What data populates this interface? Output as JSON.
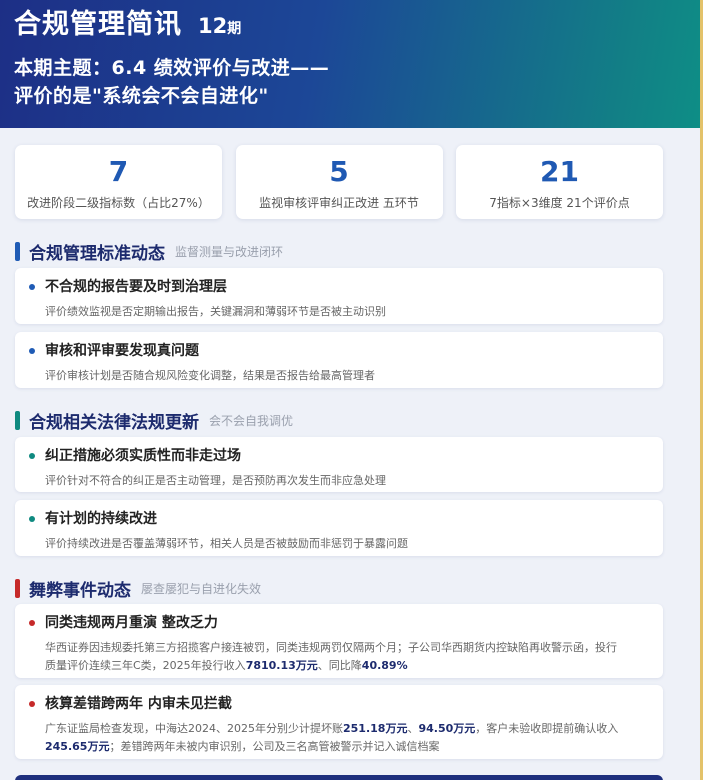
{
  "header": {
    "title": "合规管理简讯",
    "issue_number": "12",
    "issue_suffix": "期",
    "subtitle_line1": "本期主题：6.4 绩效评价与改进——",
    "subtitle_line2": "评价的是\"系统会不会自进化\""
  },
  "stats": [
    {
      "value": "7",
      "label": "改进阶段二级指标数（占比27%）"
    },
    {
      "value": "5",
      "label": "监视审核评审纠正改进 五环节"
    },
    {
      "value": "21",
      "label": "7指标×3维度 21个评价点"
    }
  ],
  "sections": [
    {
      "title": "合规管理标准动态",
      "subtitle": "监督测量与改进闭环",
      "color": "#1f5bb5",
      "items": [
        {
          "title": "不合规的报告要及时到治理层",
          "desc": "评价绩效监视是否定期输出报告，关键漏洞和薄弱环节是否被主动识别"
        },
        {
          "title": "审核和评审要发现真问题",
          "desc": "评价审核计划是否随合规风险变化调整，结果是否报告给最高管理者"
        }
      ]
    },
    {
      "title": "合规相关法律法规更新",
      "subtitle": "会不会自我调优",
      "color": "#0f8a80",
      "items": [
        {
          "title": "纠正措施必须实质性而非走过场",
          "desc": "评价针对不符合的纠正是否主动管理，是否预防再次发生而非应急处理"
        },
        {
          "title": "有计划的持续改进",
          "desc": "评价持续改进是否覆盖薄弱环节，相关人员是否被鼓励而非惩罚于暴露问题"
        }
      ]
    },
    {
      "title": "舞弊事件动态",
      "subtitle": "屡查屡犯与自进化失效",
      "color": "#c62a2a",
      "items": [
        {
          "title": "同类违规两月重演 整改乏力",
          "desc_line1": "华西证券因违规委托第三方招揽客户接连被罚，同类违规两罚仅隔两个月；子公司华西期货内控缺陷再收警示函，投行",
          "desc_line2_a": "质量评价连续三年C类，2025年投行收入",
          "desc_line2_b": "7810.13万元",
          "desc_line2_c": "、同比降",
          "desc_line2_d": "40.89%"
        },
        {
          "title": "核算差错跨两年 内审未见拦截",
          "desc_line1_a": "广东证监局检查发现，中海达2024、2025年分别少计提坏账",
          "desc_line1_b": "251.18万元",
          "desc_line1_c": "、",
          "desc_line1_d": "94.50万元",
          "desc_line1_e": "，客户未验收即提前确认收入",
          "desc_line2_a": "245.65万元",
          "desc_line2_b": "；差错跨两年未被内审识别，公司及三名高管被警示并记入诚信档案"
        }
      ]
    }
  ]
}
